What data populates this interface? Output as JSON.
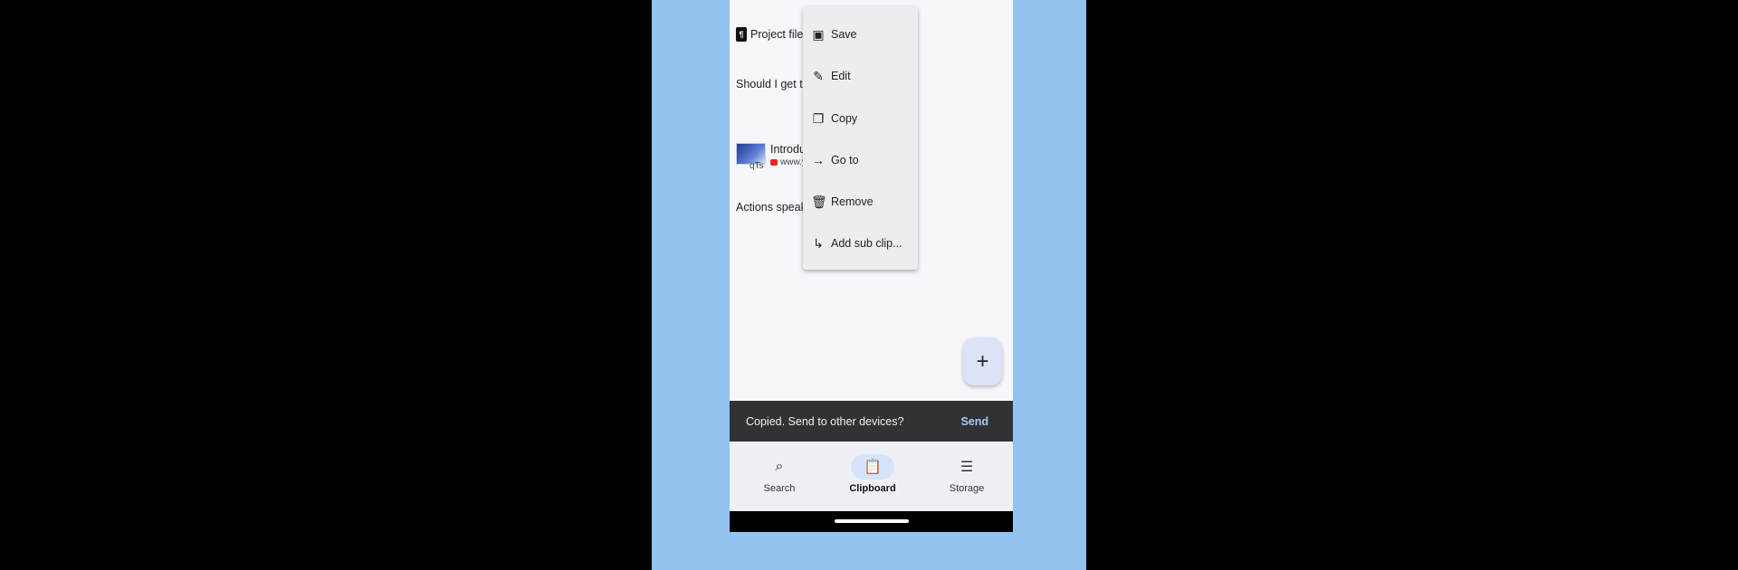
{
  "clips": {
    "file_label": "Project file",
    "question": "Should I get th",
    "link_title": "Introduc",
    "link_url": "www.y",
    "link_url_suffix": "qTs",
    "quote": "Actions speak"
  },
  "menu": {
    "items": [
      {
        "label": "Save",
        "icon": "save-icon"
      },
      {
        "label": "Edit",
        "icon": "pencil-icon"
      },
      {
        "label": "Copy",
        "icon": "copy-icon"
      },
      {
        "label": "Go to",
        "icon": "arrow-right-icon"
      },
      {
        "label": "Remove",
        "icon": "trash-icon"
      },
      {
        "label": "Add sub clip...",
        "icon": "subdirectory-arrow-icon"
      }
    ]
  },
  "fab": {
    "symbol": "+"
  },
  "snackbar": {
    "message": "Copied. Send to other devices?",
    "action": "Send"
  },
  "nav": {
    "items": [
      {
        "label": "Search",
        "icon": "search-icon"
      },
      {
        "label": "Clipboard",
        "icon": "clipboard-icon",
        "active": true
      },
      {
        "label": "Storage",
        "icon": "storage-icon"
      }
    ]
  },
  "colors": {
    "background": "#93c3ef",
    "snackbar": "#313234",
    "accent": "#a8c7fa",
    "fab": "#dbe4f7"
  }
}
